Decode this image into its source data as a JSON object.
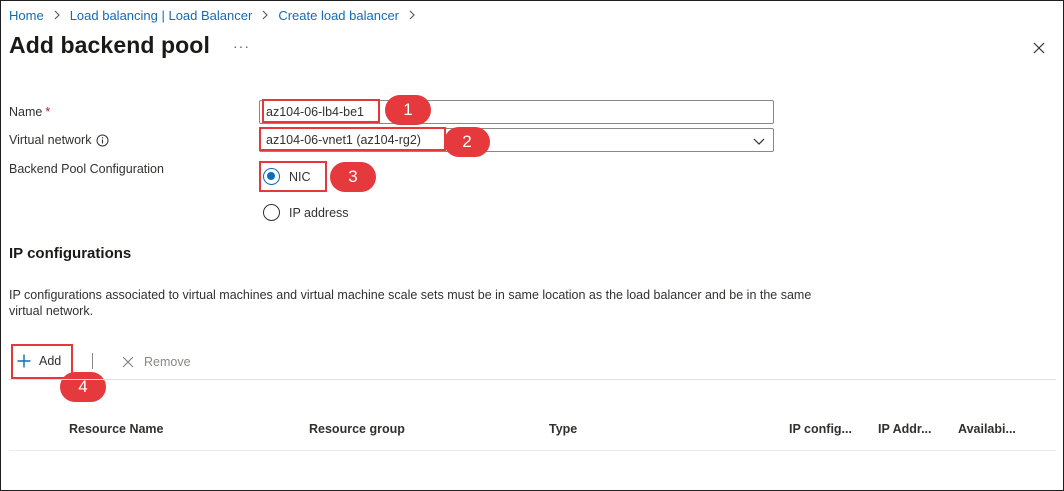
{
  "breadcrumb": [
    "Home",
    "Load balancing | Load Balancer",
    "Create load balancer"
  ],
  "page": {
    "title": "Add backend pool",
    "more_label": "···"
  },
  "form": {
    "name_label": "Name",
    "required_mark": "*",
    "name_value": "az104-06-lb4-be1",
    "vnet_label": "Virtual network",
    "vnet_value": "az104-06-vnet1 (az104-rg2)",
    "pool_config_label": "Backend Pool Configuration",
    "options": [
      {
        "label": "NIC",
        "selected": true
      },
      {
        "label": "IP address",
        "selected": false
      }
    ]
  },
  "ip_configs": {
    "title": "IP configurations",
    "description": "IP configurations associated to virtual machines and virtual machine scale sets must be in same location as the load balancer and be in the same virtual network.",
    "add_label": "Add",
    "remove_label": "Remove",
    "columns": [
      "Resource Name",
      "Resource group",
      "Type",
      "IP config...",
      "IP Addr...",
      "Availabi..."
    ]
  },
  "annotations": [
    "1",
    "2",
    "3",
    "4"
  ],
  "colors": {
    "link": "#0f6cbd",
    "accent": "#0f6cbd",
    "highlight": "#e5383b",
    "required": "#a4262c"
  },
  "icons": {
    "close": "close-icon",
    "info": "info-icon",
    "chevron": "chevron-down-icon",
    "add": "plus-icon",
    "remove": "x-icon"
  }
}
